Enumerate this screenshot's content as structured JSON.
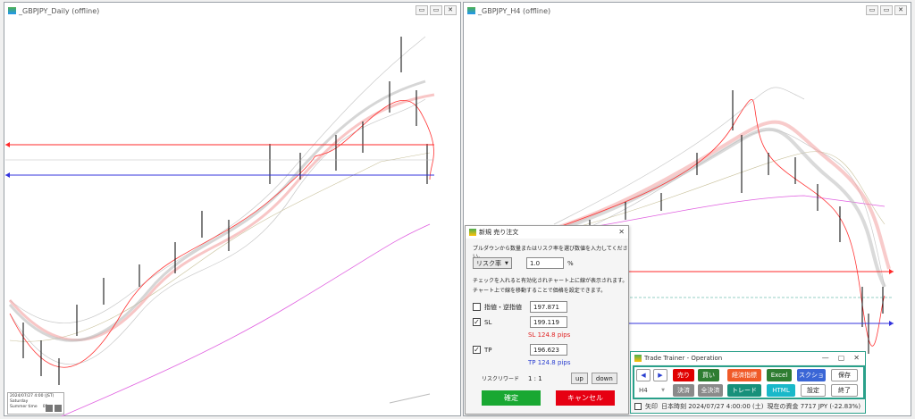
{
  "left_window": {
    "title": "_GBPJPY_Daily (offline)",
    "info_line1": "2024/07/27 4:00 (JST)",
    "info_line2": "Saturday",
    "info_line3": "Summer time",
    "info_val": "01"
  },
  "right_window": {
    "title": "_GBPJPY_H4 (offline)"
  },
  "window_controls": {
    "minimize": "▭",
    "restore": "▭",
    "close": "✕"
  },
  "dialog": {
    "title": "新規 売り注文",
    "instruction": "プルダウンから数量またはリスク率を選び数値を入力してください。",
    "mode_select": "リスク率",
    "mode_value": "1.0",
    "mode_unit": "%",
    "note_line1": "チェックを入れると有効化されチャート上に線が表示されます。",
    "note_line2": "チャート上で線を移動することで価格を設定できます。",
    "stop_entry": {
      "checked": false,
      "label": "指値・逆指値",
      "value": "197.871"
    },
    "sl": {
      "checked": true,
      "label": "SL",
      "value": "199.119",
      "pips": "SL 124.8 pips"
    },
    "tp": {
      "checked": true,
      "label": "TP",
      "value": "196.623",
      "pips": "TP 124.8 pips"
    },
    "risk_reward_label": "リスクリワード",
    "risk_reward_value": "1 : 1",
    "up_label": "up",
    "down_label": "down",
    "confirm_label": "確定",
    "cancel_label": "キャンセル"
  },
  "operation": {
    "title": "Trade Trainer - Operation",
    "timeframe": "H4",
    "buttons": {
      "prev": "◀",
      "next": "▶",
      "sell": "売り",
      "buy": "買い",
      "econ": "経済指標",
      "excel": "Excel",
      "screenshot": "スクショ",
      "save": "保存",
      "settle": "決済",
      "settle_all": "全決済",
      "trend": "トレード",
      "html": "HTML",
      "settings": "設定",
      "exit": "終了"
    },
    "status": {
      "arrow_label": "矢印",
      "time": "日本時刻 2024/07/27 4:00:00 (土)",
      "funds": "現在の資金 7717 JPY (-22.83%)"
    }
  },
  "colors": {
    "sell": "#e00000",
    "buy": "#2e7d32",
    "econ": "#f05a28",
    "excel": "#2e7d32",
    "screenshot": "#3a66d6",
    "settle": "#8a8a8a",
    "trend": "#17907a",
    "html": "#19b8c9",
    "confirm": "#19a832",
    "cancel": "#e60012",
    "sl_line": "#ff2a2a",
    "tp_line": "#3333dd"
  }
}
